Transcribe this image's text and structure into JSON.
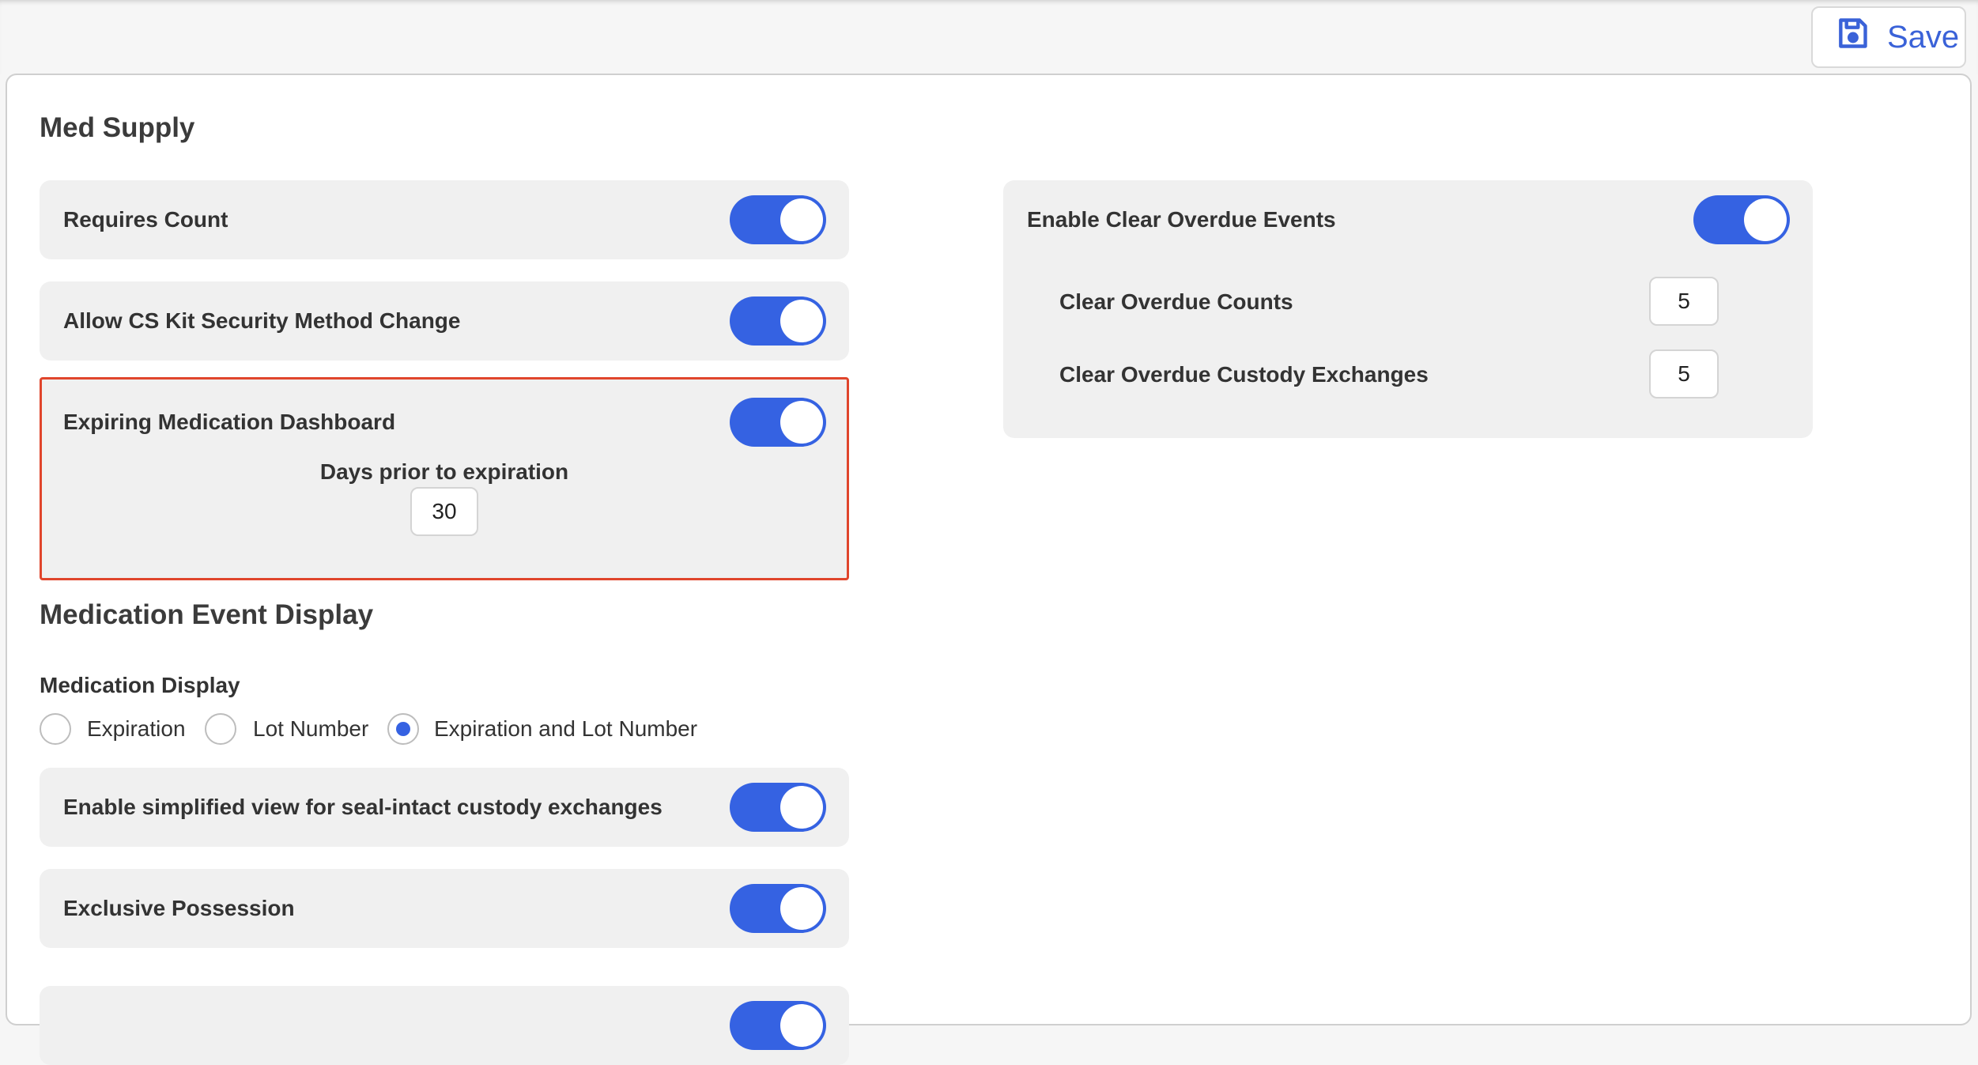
{
  "toolbar": {
    "save_label": "Save",
    "save_icon": "floppy-disk-icon",
    "accent": "#3a62d8"
  },
  "med_supply": {
    "title": "Med Supply",
    "requires_count": {
      "label": "Requires Count",
      "enabled": true
    },
    "allow_cs_kit": {
      "label": "Allow CS Kit Security Method Change",
      "enabled": true
    },
    "expiring_dashboard": {
      "label": "Expiring Medication Dashboard",
      "enabled": true,
      "days_label": "Days prior to expiration",
      "days_value": "30",
      "highlight_color": "#e0452c"
    },
    "clear_overdue": {
      "label": "Enable Clear Overdue Events",
      "enabled": true,
      "counts_label": "Clear Overdue Counts",
      "counts_value": "5",
      "custody_label": "Clear Overdue Custody Exchanges",
      "custody_value": "5"
    }
  },
  "med_event_display": {
    "title": "Medication Event Display",
    "medication_display_label": "Medication Display",
    "options": [
      "Expiration",
      "Lot Number",
      "Expiration and Lot Number"
    ],
    "selected": "Expiration and Lot Number",
    "simplified_view": {
      "label": "Enable simplified view for seal-intact custody exchanges",
      "enabled": true
    },
    "exclusive_possession": {
      "label": "Exclusive Possession",
      "enabled": true
    }
  },
  "colors": {
    "toggle_on": "#3562e2",
    "row_bg": "#f0f0f0"
  }
}
